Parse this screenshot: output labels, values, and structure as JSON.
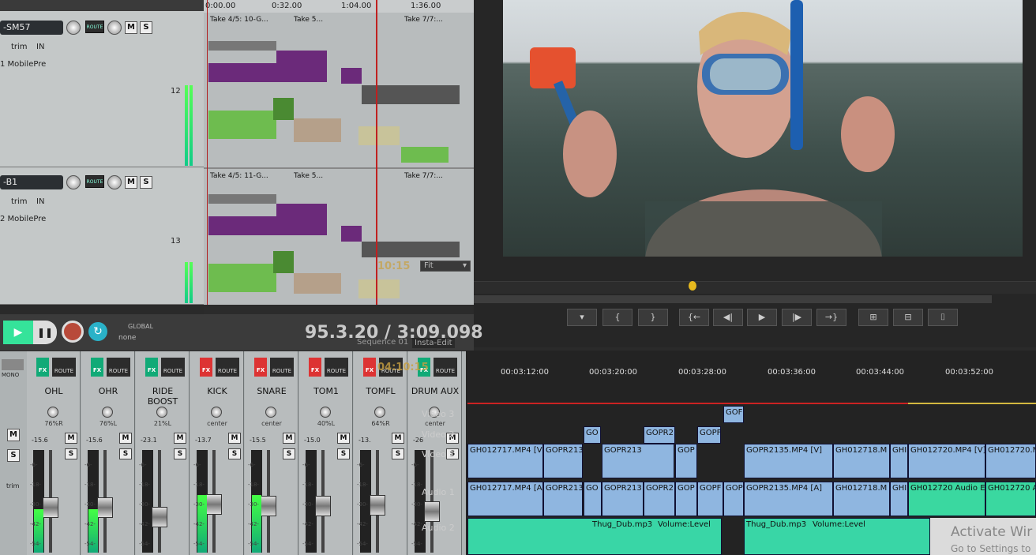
{
  "reaper_tracks": [
    {
      "name": "-SM57",
      "number": "12",
      "trim": "trim",
      "input": "IN",
      "input_device": "1 MobilePre",
      "route": "ROUTE",
      "mute": "M",
      "solo": "S"
    },
    {
      "name": "-B1",
      "number": "13",
      "trim": "trim",
      "input": "IN",
      "input_device": "2 MobilePre",
      "route": "ROUTE",
      "mute": "M",
      "solo": "S"
    }
  ],
  "ruler": {
    "marks": [
      "0:00.00",
      "0:32.00",
      "1:04.00",
      "1:36.00"
    ]
  },
  "takes_row1": [
    "Take 4/5: 10-G...",
    "Take 5...",
    "Take 7/7:..."
  ],
  "takes_row2": [
    "Take 4/5: 11-G...",
    "Take 5...",
    "Take 7/7:..."
  ],
  "transport": {
    "time": "95.3.20 / 3:09.098",
    "global_label": "GLOBAL",
    "global_value": "none",
    "overlay_tc": "10:15",
    "fit": "Fit",
    "sequence": "Sequence 01",
    "insta_edit": "Insta-Edit",
    "overlay_tc2": "04:10:15"
  },
  "mixer": {
    "mono": "MONO",
    "trim": "trim",
    "route": "ROUTE",
    "fx": "FX",
    "channels": [
      {
        "name": "OHL",
        "pan": "76%R",
        "vol": "-15.6",
        "fx_on": true
      },
      {
        "name": "OHR",
        "pan": "76%L",
        "vol": "-15.6",
        "fx_on": true
      },
      {
        "name": "RIDE BOOST",
        "pan": "21%L",
        "vol": "-23.1",
        "fx_on": true
      },
      {
        "name": "KICK",
        "pan": "center",
        "vol": "-13.7",
        "fx_on": false
      },
      {
        "name": "SNARE",
        "pan": "center",
        "vol": "-15.5",
        "fx_on": false
      },
      {
        "name": "TOM1",
        "pan": "40%L",
        "vol": "-15.0",
        "fx_on": false
      },
      {
        "name": "TOMFL",
        "pan": "64%R",
        "vol": "-13.",
        "fx_on": false
      },
      {
        "name": "DRUM AUX",
        "pan": "center",
        "vol": "-26",
        "fx_on": true
      }
    ],
    "scale": [
      "-6-",
      "-18-",
      "-30-",
      "-42-",
      "-54-"
    ]
  },
  "premiere": {
    "timecodes": [
      "00:03:12:00",
      "00:03:20:00",
      "00:03:28:00",
      "00:03:36:00",
      "00:03:44:00",
      "00:03:52:00"
    ],
    "tracks": [
      "Video 3",
      "Video 2",
      "Video 1",
      "Audio 1",
      "Audio 2"
    ],
    "video3": [
      "GOF"
    ],
    "video2": [
      "GO",
      "GOPR2",
      "GOPF"
    ],
    "video1": [
      "GH012717.MP4 [V]",
      "GOPR213",
      "GOPR213",
      "GOP",
      "GOPR2135.MP4 [V]",
      "GH012718.M",
      "GHI",
      "GH012720.MP4 [V]",
      "GH012720.M"
    ],
    "audio1": [
      "GH012717.MP4 [A]",
      "GOPR213",
      "GO",
      "GOPR213",
      "GOPR2",
      "GOP",
      "GOPF",
      "GOP",
      "GOPR2135.MP4 [A]",
      "GH012718.M",
      "GHI",
      "GH012720 Audio E",
      "GH012720 A"
    ],
    "audio2": [
      "Thug_Dub.mp3",
      "Volume:Level",
      "Thug_Dub.mp3",
      "Volume:Level"
    ],
    "activate": "Activate Wir",
    "settings": "Go to Settings to"
  },
  "controls": {
    "marker": "▾",
    "in": "{",
    "out": "}",
    "goto_in": "{←",
    "step_back": "◀|",
    "play": "▶",
    "step_fwd": "|▶",
    "goto_out": "→}",
    "insert": "⊞",
    "overwrite": "⊟",
    "export": "⌷"
  },
  "colors": {
    "reaper_bg": "#c4c8c8",
    "premiere_bg": "#232323",
    "purple": "#6b2a7a",
    "green": "#6ebc4f",
    "tan": "#b5a08a",
    "clip_blue": "#8fb6e0",
    "music_green": "#39d6a6",
    "play_green": "#35e39a",
    "rec_red": "#b84a3a"
  }
}
